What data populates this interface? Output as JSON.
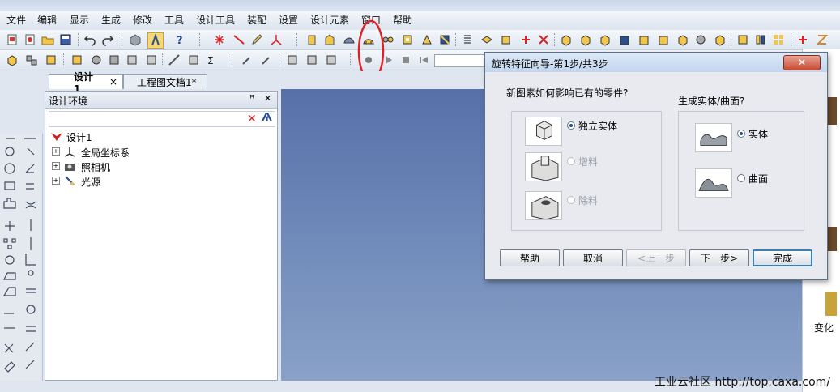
{
  "menubar": {
    "items": [
      "文件",
      "编辑",
      "显示",
      "生成",
      "修改",
      "工具",
      "设计工具",
      "装配",
      "设置",
      "设计元素",
      "窗口",
      "帮助"
    ]
  },
  "tabs": [
    {
      "label": "设计1",
      "active": true
    },
    {
      "label": "工程图文档1*",
      "active": false
    }
  ],
  "panel": {
    "title": "设计环境",
    "pin_glyph": "ꟸ",
    "close_glyph": "✕",
    "tree": [
      {
        "label": "设计1",
        "level": 0
      },
      {
        "label": "全局坐标系",
        "level": 1
      },
      {
        "label": "照相机",
        "level": 1
      },
      {
        "label": "光源",
        "level": 1
      }
    ]
  },
  "dialog": {
    "title": "旋转特征向导-第1步/共3步",
    "close_glyph": "✕",
    "question_left": "新图素如何影响已有的零件?",
    "question_right": "生成实体/曲面?",
    "left_options": [
      {
        "label": "独立实体",
        "selected": true,
        "enabled": true
      },
      {
        "label": "增料",
        "selected": false,
        "enabled": false
      },
      {
        "label": "除料",
        "selected": false,
        "enabled": false
      }
    ],
    "right_options": [
      {
        "label": "实体",
        "selected": true,
        "enabled": true
      },
      {
        "label": "曲面",
        "selected": false,
        "enabled": true
      }
    ],
    "buttons": {
      "help": "帮助",
      "cancel": "取消",
      "prev": "<上一步",
      "next": "下一步>",
      "finish": "完成"
    }
  },
  "right_edge": {
    "label": "变化"
  },
  "watermark": "工业云社区 http://top.caxa.com/",
  "colors": {
    "highlight_circle": "#d9252a",
    "viewport_top": "#5870a8",
    "viewport_bottom": "#8aa2c8"
  }
}
